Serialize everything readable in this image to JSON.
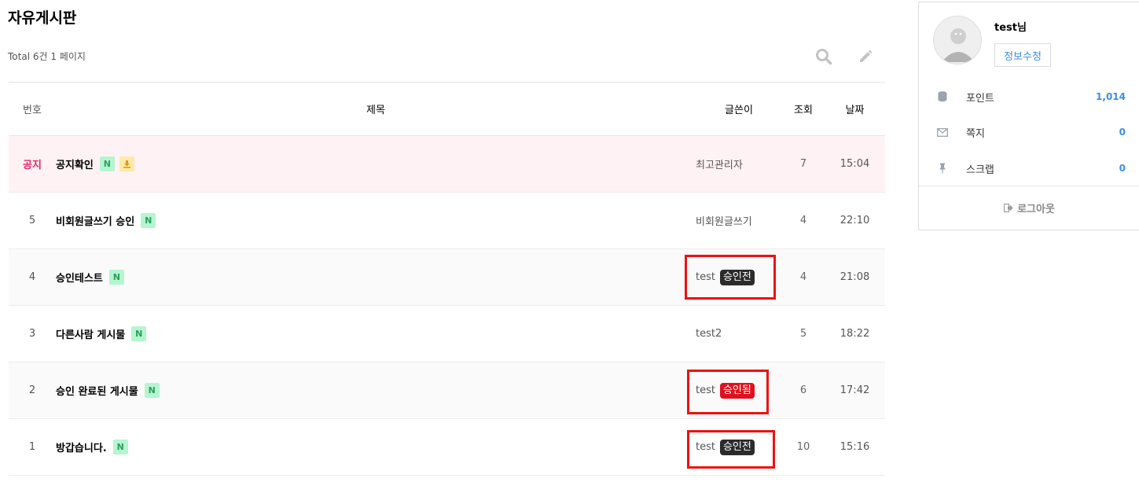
{
  "board": {
    "title": "자유게시판",
    "total_text": "Total 6건 1 페이지"
  },
  "toolbar": {
    "search_icon": "search-icon",
    "write_icon": "pencil-icon"
  },
  "table": {
    "headers": {
      "num": "번호",
      "title": "제목",
      "writer": "글쓴이",
      "hits": "조회",
      "date": "날짜"
    },
    "rows": [
      {
        "num": "공지",
        "title": "공지확인",
        "new": "N",
        "file": true,
        "writer": "최고관리자",
        "status": "",
        "hits": "7",
        "date": "15:04"
      },
      {
        "num": "5",
        "title": "비회원글쓰기 승인",
        "new": "N",
        "writer": "비회원글쓰기",
        "status": "",
        "hits": "4",
        "date": "22:10"
      },
      {
        "num": "4",
        "title": "승인테스트",
        "new": "N",
        "writer": "test",
        "status": "승인전",
        "hits": "4",
        "date": "21:08"
      },
      {
        "num": "3",
        "title": "다른사람 게시물",
        "new": "N",
        "writer": "test2",
        "status": "",
        "hits": "5",
        "date": "18:22"
      },
      {
        "num": "2",
        "title": "승인 완료된 게시물",
        "new": "N",
        "writer": "test",
        "status": "승인됨",
        "hits": "6",
        "date": "17:42"
      },
      {
        "num": "1",
        "title": "방갑습니다.",
        "new": "N",
        "writer": "test",
        "status": "승인전",
        "hits": "10",
        "date": "15:16"
      }
    ]
  },
  "colors": {
    "notice_bg": "#fff2f5",
    "notice_text": "#e8246a",
    "status_pending": "#2b2b2b",
    "status_approved": "#e0111f",
    "accent": "#3a8ee6",
    "highlight_box": "#ee1111"
  },
  "sidebar": {
    "user_name": "test님",
    "edit_label": "정보수정",
    "stats": [
      {
        "icon": "database-icon",
        "label": "포인트",
        "value": "1,014"
      },
      {
        "icon": "envelope-icon",
        "label": "쪽지",
        "value": "0"
      },
      {
        "icon": "pin-icon",
        "label": "스크랩",
        "value": "0"
      }
    ],
    "logout_label": "로그아웃",
    "logout_icon": "sign-out-icon"
  }
}
